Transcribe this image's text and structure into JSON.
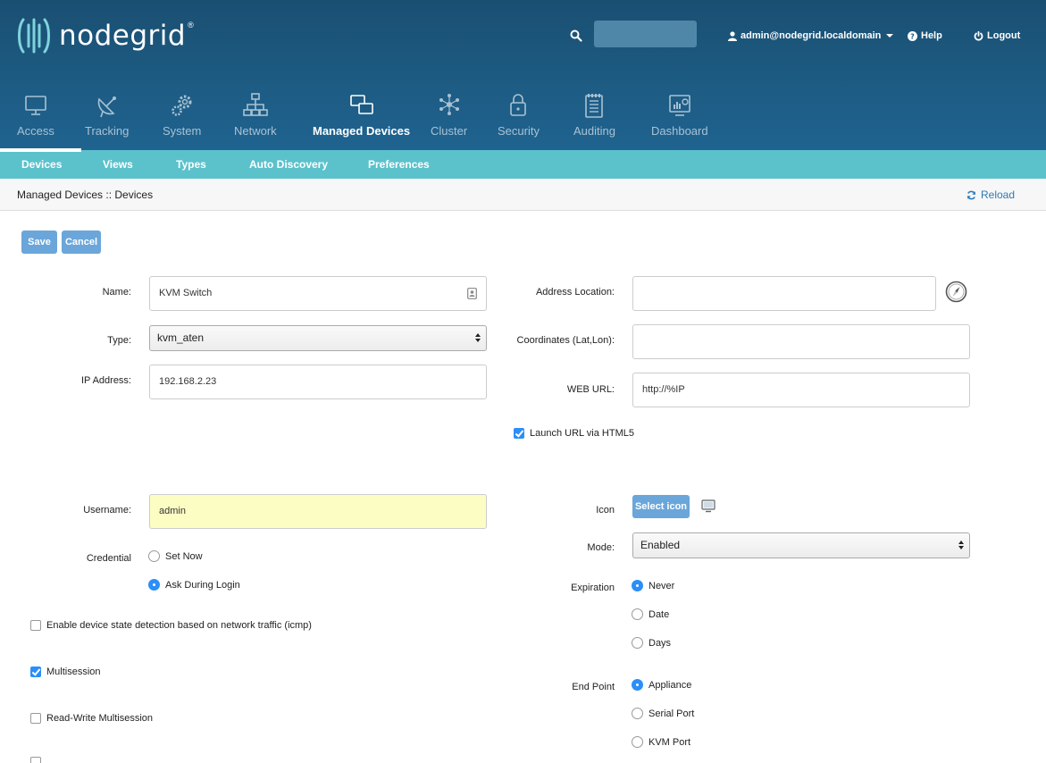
{
  "header": {
    "logo_text": "nodegrid",
    "logo_reg": "®",
    "search_placeholder": "",
    "user": "admin@nodegrid.localdomain",
    "help": "Help",
    "logout": "Logout"
  },
  "main_nav": [
    {
      "label": "Access",
      "icon": "monitor-icon"
    },
    {
      "label": "Tracking",
      "icon": "satellite-dish-icon"
    },
    {
      "label": "System",
      "icon": "gears-icon"
    },
    {
      "label": "Network",
      "icon": "network-icon"
    },
    {
      "label": "Managed Devices",
      "icon": "devices-icon",
      "active": true
    },
    {
      "label": "Cluster",
      "icon": "cluster-icon"
    },
    {
      "label": "Security",
      "icon": "lock-icon"
    },
    {
      "label": "Auditing",
      "icon": "clipboard-icon"
    },
    {
      "label": "Dashboard",
      "icon": "dashboard-icon"
    }
  ],
  "sub_nav": [
    "Devices",
    "Views",
    "Types",
    "Auto Discovery",
    "Preferences"
  ],
  "breadcrumb": "Managed Devices :: Devices",
  "reload": "Reload",
  "actions": {
    "save": "Save",
    "cancel": "Cancel"
  },
  "form": {
    "name_label": "Name:",
    "name_value": "KVM Switch",
    "type_label": "Type:",
    "type_value": "kvm_aten",
    "ip_label": "IP Address:",
    "ip_value": "192.168.2.23",
    "address_label": "Address Location:",
    "address_value": "",
    "coords_label": "Coordinates (Lat,Lon):",
    "coords_value": "",
    "web_url_label": "WEB URL:",
    "web_url_value": "http://%IP",
    "launch_html5": "Launch URL via HTML5",
    "username_label": "Username:",
    "username_value": "admin",
    "credential_label": "Credential",
    "credential_set_now": "Set Now",
    "credential_ask": "Ask During Login",
    "icon_label": "Icon",
    "select_icon": "Select icon",
    "mode_label": "Mode:",
    "mode_value": "Enabled",
    "expiration_label": "Expiration",
    "exp_never": "Never",
    "exp_date": "Date",
    "exp_days": "Days",
    "endpoint_label": "End Point",
    "ep_appliance": "Appliance",
    "ep_serial": "Serial Port",
    "ep_kvm": "KVM Port",
    "icmp_detection": "Enable device state detection based on network traffic (icmp)",
    "multisession": "Multisession",
    "rw_multisession": "Read-Write Multisession"
  }
}
